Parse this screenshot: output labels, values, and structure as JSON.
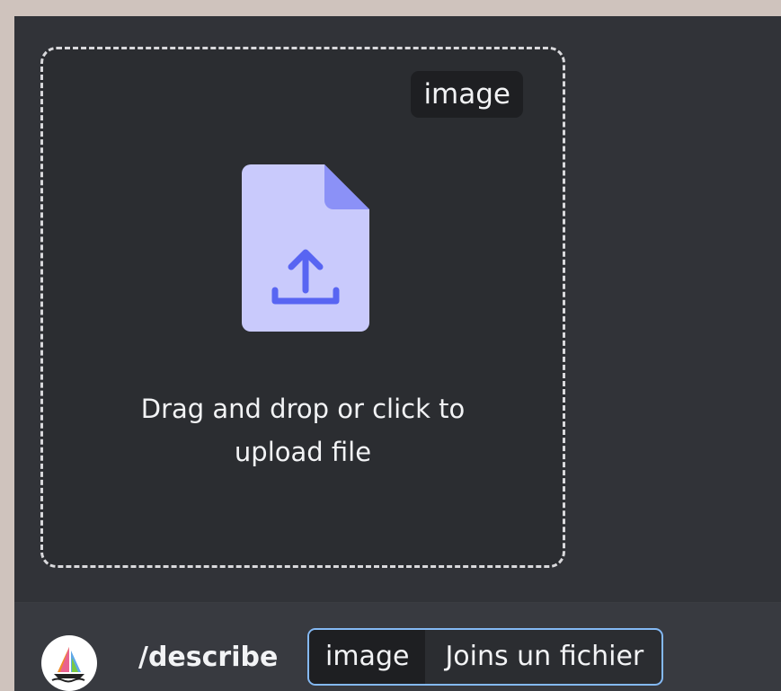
{
  "upload": {
    "option_tag": "image",
    "hint": "Drag and drop or click to\nupload file",
    "icon": "file-upload-icon"
  },
  "command": {
    "avatar_icon": "midjourney-sailboat-icon",
    "name": "/describe",
    "option_key": "image",
    "option_value": "Joins un fichier"
  },
  "colors": {
    "background": "#313338",
    "dropzone": "#2b2d31",
    "file_icon": "#c9cafc",
    "file_icon_fold": "#8b91f7",
    "upload_arrow": "#5865f2",
    "focus_border": "#84b9f4"
  }
}
